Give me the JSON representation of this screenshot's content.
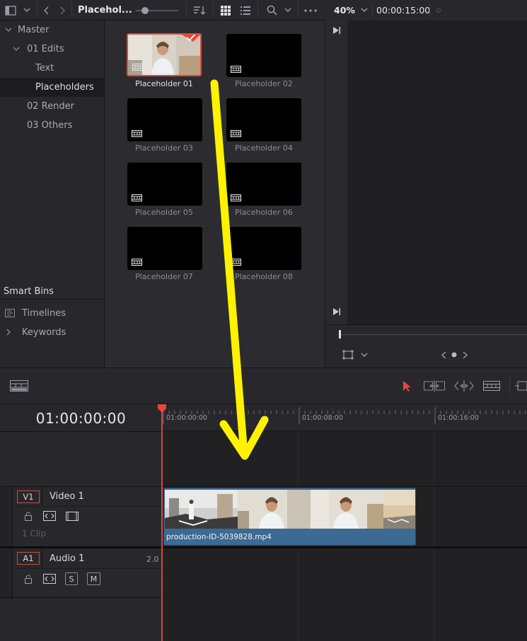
{
  "toolbar": {
    "bin_title": "Placehol...",
    "zoom_level": "40%",
    "timecode": "00:00:15:00"
  },
  "bins": {
    "master": "Master",
    "edits": "01 Edits",
    "text": "Text",
    "placeholders": "Placeholders",
    "render": "02 Render",
    "others": "03 Others"
  },
  "smart_bins": {
    "header": "Smart Bins",
    "timelines": "Timelines",
    "keywords": "Keywords"
  },
  "clips": [
    {
      "label": "Placeholder 01"
    },
    {
      "label": "Placeholder 02"
    },
    {
      "label": "Placeholder 03"
    },
    {
      "label": "Placeholder 04"
    },
    {
      "label": "Placeholder 05"
    },
    {
      "label": "Placeholder 06"
    },
    {
      "label": "Placeholder 07"
    },
    {
      "label": "Placeholder 08"
    }
  ],
  "timeline": {
    "timecode": "01:00:00:00",
    "ruler": [
      "01:00:00:00",
      "01:00:08:00",
      "01:00:16:00"
    ],
    "video_track": {
      "tag": "V1",
      "name": "Video 1",
      "clip_count": "1 Clip"
    },
    "audio_track": {
      "tag": "A1",
      "name": "Audio 1",
      "channels": "2.0",
      "solo": "S",
      "mute": "M"
    },
    "clip_name": "production-ID-5039828.mp4"
  },
  "colors": {
    "accent_red": "#e4483c",
    "clip_blue": "#3c6a92",
    "arrow_yellow": "#fff200"
  }
}
